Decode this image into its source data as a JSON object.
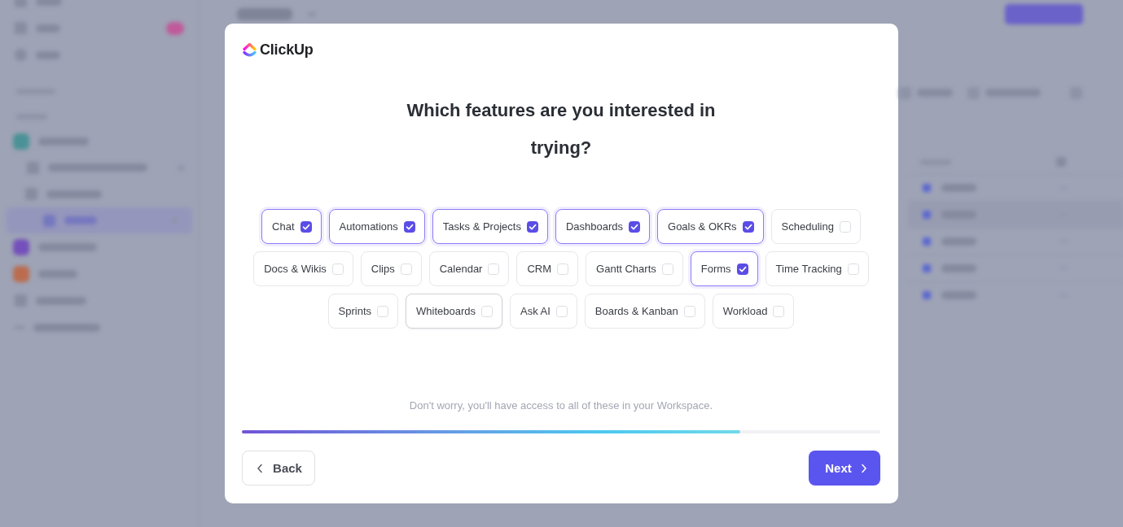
{
  "logo": {
    "text": "ClickUp"
  },
  "title": "Which features are you interested in trying?",
  "features": [
    {
      "label": "Chat",
      "checked": true,
      "hovered": false
    },
    {
      "label": "Automations",
      "checked": true,
      "hovered": false
    },
    {
      "label": "Tasks & Projects",
      "checked": true,
      "hovered": false
    },
    {
      "label": "Dashboards",
      "checked": true,
      "hovered": false
    },
    {
      "label": "Goals & OKRs",
      "checked": true,
      "hovered": false
    },
    {
      "label": "Scheduling",
      "checked": false,
      "hovered": false
    },
    {
      "label": "Docs & Wikis",
      "checked": false,
      "hovered": false
    },
    {
      "label": "Clips",
      "checked": false,
      "hovered": false
    },
    {
      "label": "Calendar",
      "checked": false,
      "hovered": false
    },
    {
      "label": "CRM",
      "checked": false,
      "hovered": false
    },
    {
      "label": "Gantt Charts",
      "checked": false,
      "hovered": false
    },
    {
      "label": "Forms",
      "checked": true,
      "hovered": false
    },
    {
      "label": "Time Tracking",
      "checked": false,
      "hovered": false
    },
    {
      "label": "Sprints",
      "checked": false,
      "hovered": false
    },
    {
      "label": "Whiteboards",
      "checked": false,
      "hovered": true
    },
    {
      "label": "Ask AI",
      "checked": false,
      "hovered": false
    },
    {
      "label": "Boards & Kanban",
      "checked": false,
      "hovered": false
    },
    {
      "label": "Workload",
      "checked": false,
      "hovered": false
    }
  ],
  "note": "Don't worry, you'll have access to all of these in your Workspace.",
  "progress": {
    "level": 0.78
  },
  "back_button": {
    "label": "Back"
  },
  "next_button": {
    "label": "Next"
  }
}
